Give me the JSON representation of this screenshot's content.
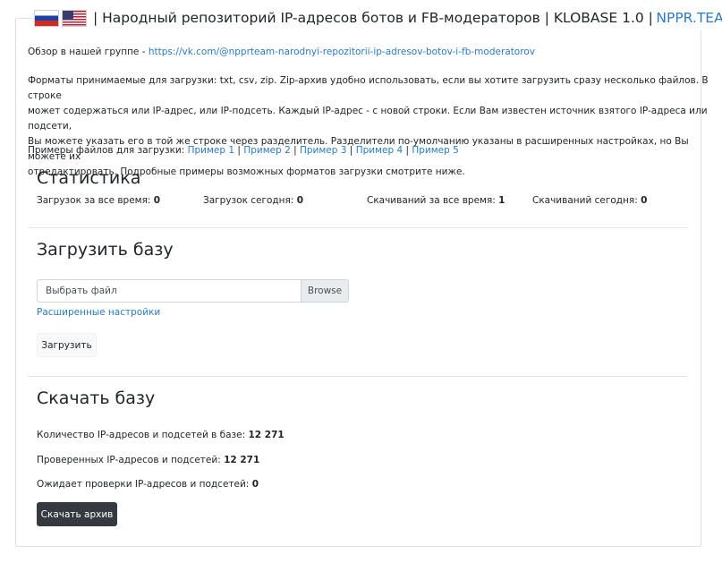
{
  "header": {
    "title": "| Народный репозиторий IP-адресов ботов и FB-модераторов | KLOBASE 1.0 |",
    "brand_link": "NPPR.TEAM",
    "flag_ru_icon": "flag-russia",
    "flag_us_icon": "flag-usa"
  },
  "intro": {
    "overview_label": "Обзор в нашей группе -",
    "overview_link": "https://vk.com/@npprteam-narodnyi-repozitorii-ip-adresov-botov-i-fb-moderatorov",
    "formats_lines": [
      "Форматы принимаемые для загрузки: txt, csv, zip. Zip-архив удобно использовать, если вы хотите загрузить сразу несколько файлов. В строке",
      "может содержаться или IP-адрес, или IP-подсеть. Каждый IP-адрес - с новой строки. Если Вам известен источник взятого IP-адреса или подсети,",
      "Вы можете указать его в той же строке через разделитель. Разделители по-умолчанию указаны в расширенных настройках, но Вы можете их",
      "отредактировать. Подробные примеры возможных форматов загрузки смотрите ниже."
    ],
    "examples_label": "Примеры файлов для загрузки:",
    "examples": [
      "Пример 1",
      "Пример 2",
      "Пример 3",
      "Пример 4",
      "Пример 5"
    ],
    "separator": "|"
  },
  "stats": {
    "heading": "Статистика",
    "items": [
      {
        "label": "Загрузок за все время:",
        "value": "0"
      },
      {
        "label": "Загрузок сегодня:",
        "value": "0"
      },
      {
        "label": "Скачиваний за все время:",
        "value": "1"
      },
      {
        "label": "Скачиваний сегодня:",
        "value": "0"
      }
    ]
  },
  "upload": {
    "heading": "Загрузить базу",
    "file_placeholder": "Выбрать файл",
    "browse_label": "Browse",
    "advanced_link": "Расширенные настройки",
    "submit_label": "Загрузить"
  },
  "download": {
    "heading": "Скачать базу",
    "lines": [
      {
        "label": "Количество IP-адресов и подсетей в базе:",
        "value": "12 271"
      },
      {
        "label": "Проверенных IP-адресов и подсетей:",
        "value": "12 271"
      },
      {
        "label": "Ожидает проверки IP-адресов и подсетей:",
        "value": "0"
      }
    ],
    "button_label": "Скачать архив"
  },
  "colors": {
    "link": "#2b7bc2",
    "dark_button": "#343a40",
    "border": "#dfdfdf"
  }
}
